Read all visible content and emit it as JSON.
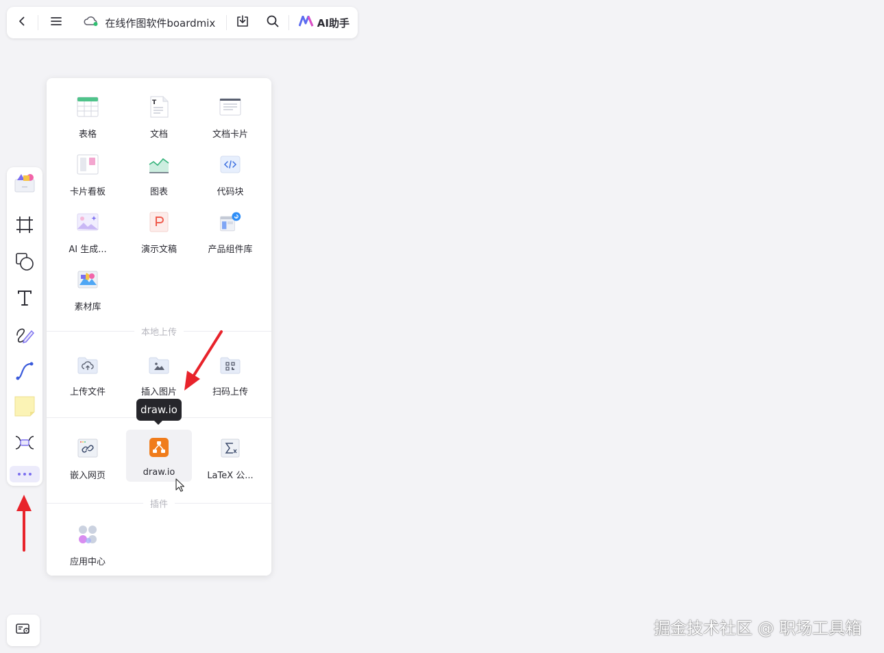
{
  "topbar": {
    "back_icon": "chevron-left-icon",
    "menu_icon": "hamburger-menu-icon",
    "cloud_icon": "cloud-synced-icon",
    "file_title": "在线作图软件boardmix",
    "download_icon": "download-icon",
    "search_icon": "search-icon",
    "ai_label": "AI助手"
  },
  "leftbar": {
    "tools": [
      "templates-icon",
      "frame-icon",
      "shape-icon",
      "text-icon",
      "pen-icon",
      "connector-icon",
      "sticky-note-icon",
      "mindmap-icon",
      "more-icon"
    ]
  },
  "panel": {
    "sections": [
      {
        "title": "",
        "items": [
          "表格",
          "文档",
          "文档卡片",
          "卡片看板",
          "图表",
          "代码块",
          "AI 生成...",
          "演示文稿",
          "产品组件库",
          "素材库"
        ]
      },
      {
        "title": "本地上传",
        "items": [
          "上传文件",
          "插入图片",
          "扫码上传"
        ]
      },
      {
        "title": "",
        "items": [
          "嵌入网页",
          "draw.io",
          "LaTeX 公..."
        ]
      },
      {
        "title": "插件",
        "items": [
          "应用中心"
        ]
      }
    ]
  },
  "tooltip": "draw.io",
  "watermark": "掘金技术社区 @ 职场工具箱",
  "colors": {
    "accent": "#7b6ff0",
    "arrow": "#e8232b",
    "drawio": "#f07c1b",
    "canvas": "#f3f3f6"
  }
}
